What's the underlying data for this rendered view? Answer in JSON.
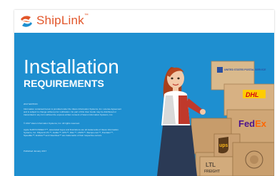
{
  "brand": {
    "name": "ShipLink",
    "mark": "™"
  },
  "cover": {
    "title": "Installation",
    "subtitle": "REQUIREMENTS",
    "edition": "2017 EDITION",
    "legal": "Information contained herein is provided under the Vasco Information Systems, Inc. License Agreement and is subject to change without prior notification. No part of this User Guide may be distributed or transmitted in any form without the express written consent of Vasco Information Systems, Inc.",
    "copyright": "© 2017 Vasco Information Systems, Inc. All rights reserved.",
    "trademarks": "Apple SHIP/CONNECT™, associated logos and illustrations are all trademarks of Vasco Information Systems, Inc. ShipLink LTL™, FedEx™, UPS™, DHL™, USPS™, Stamps.com™, Purolator™, SpeedEe™, Endicia™ and ClearView™ are trademarks of their respective owners.",
    "published": "Published January 2017"
  },
  "boxes": {
    "usps": "UNITED STATES POSTAL SERVICE",
    "dhl": "DHL",
    "fedex_a": "Fed",
    "fedex_b": "Ex",
    "ups": "ups",
    "ltl_a": "LTL",
    "ltl_b": "FREIGHT"
  },
  "colors": {
    "background": "#1e8fd0",
    "brand": "#e2562a",
    "fedex_purple": "#4d148c",
    "fedex_orange": "#ff6600",
    "ups_brown": "#5a3a1a",
    "ups_gold": "#f5b31b",
    "dhl_red": "#d40511",
    "usps_blue": "#2a4fa0",
    "cardboard": "#c9a273"
  }
}
